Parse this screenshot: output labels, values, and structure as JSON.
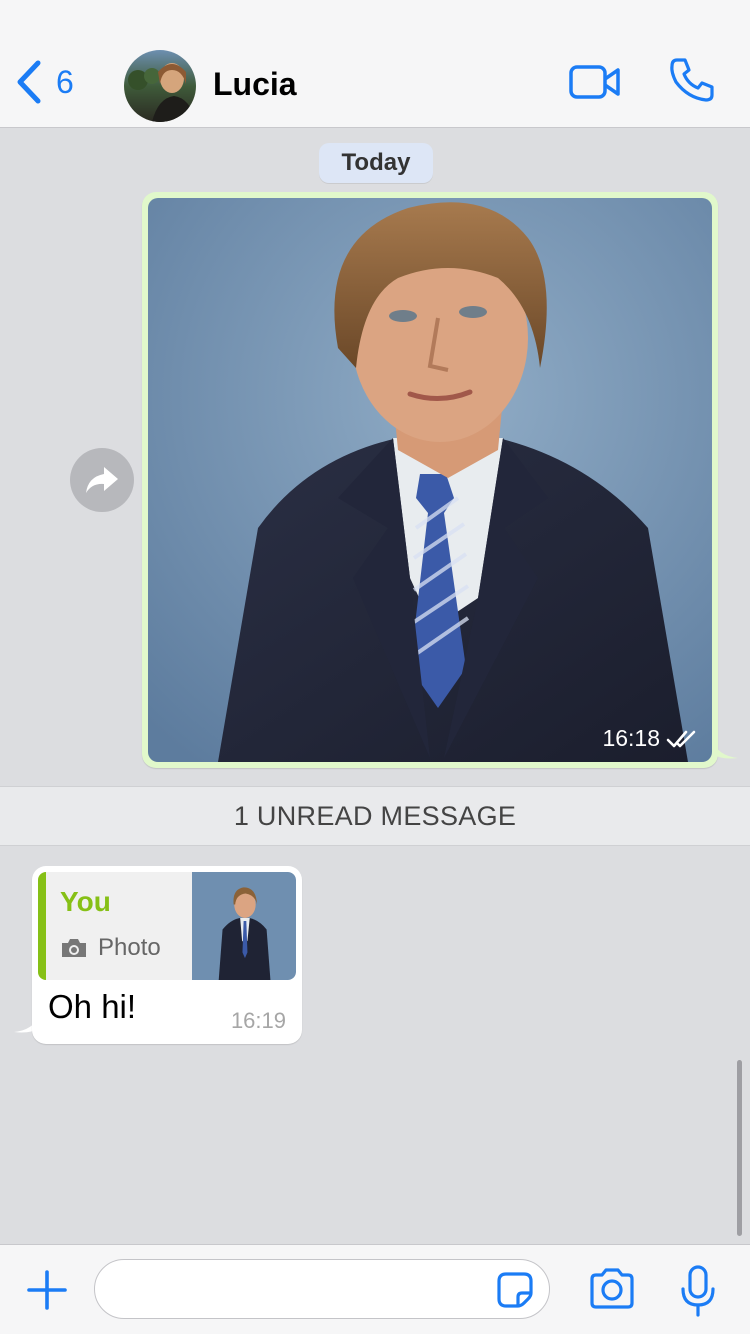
{
  "header": {
    "back_count": "6",
    "contact_name": "Lucia"
  },
  "chat": {
    "date_label": "Today",
    "outgoing_photo": {
      "time": "16:18",
      "status": "read-double-check"
    },
    "unread_banner": "1 UNREAD MESSAGE",
    "incoming": {
      "reply_author": "You",
      "reply_type": "Photo",
      "text": "Oh hi!",
      "time": "16:19"
    }
  },
  "input": {
    "placeholder": ""
  },
  "colors": {
    "accent": "#1b7cf5",
    "outgoing_bubble": "#e1f8cb",
    "reply_bar": "#86c016",
    "background": "#dcdde0"
  },
  "icons": {
    "back": "chevron-left-icon",
    "video": "video-camera-icon",
    "call": "phone-icon",
    "forward": "share-arrow-icon",
    "plus": "plus-icon",
    "sticker": "sticker-icon",
    "camera": "camera-icon",
    "mic": "microphone-icon"
  }
}
